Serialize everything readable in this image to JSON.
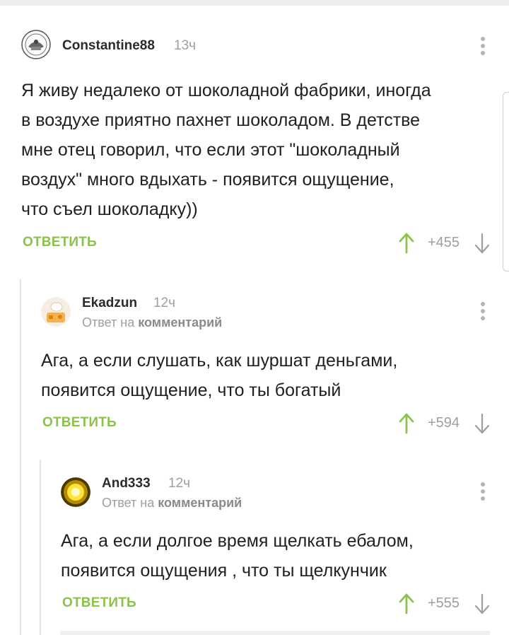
{
  "comments": [
    {
      "username": "Constantine88",
      "time": "13ч",
      "text_lines": [
        "Я живу недалеко от шоколадной фабрики, иногда",
        "в воздухе приятно пахнет шоколадом. В детстве",
        "мне отец говорил, что если этот \"шоколадный",
        "воздух\" много вдыхать - появится ощущение,",
        "что съел шоколадку))"
      ],
      "reply_label": "ОТВЕТИТЬ",
      "rating": "+455",
      "avatar_icon": "emblem-avatar-icon"
    },
    {
      "username": "Ekadzun",
      "time": "12ч",
      "reply_to_prefix": "Ответ на",
      "reply_to_link": "комментарий",
      "text_lines": [
        "Ага, а если слушать, как шуршат деньгами,",
        "появится ощущение, что ты богатый"
      ],
      "reply_label": "ОТВЕТИТЬ",
      "rating": "+594",
      "avatar_icon": "chef-avatar-icon"
    },
    {
      "username": "And333",
      "time": "12ч",
      "reply_to_prefix": "Ответ на",
      "reply_to_link": "комментарий",
      "text_lines": [
        "Ага, а если долгое время щелкать ебалом,",
        "появится ощущения , что ты щелкунчик"
      ],
      "reply_label": "ОТВЕТИТЬ",
      "rating": "+555",
      "avatar_icon": "sun-avatar-icon"
    }
  ],
  "colors": {
    "accent": "#8bc34a",
    "text": "#212121",
    "muted": "#9e9e9e",
    "thread_line": "#e2e2e2"
  }
}
